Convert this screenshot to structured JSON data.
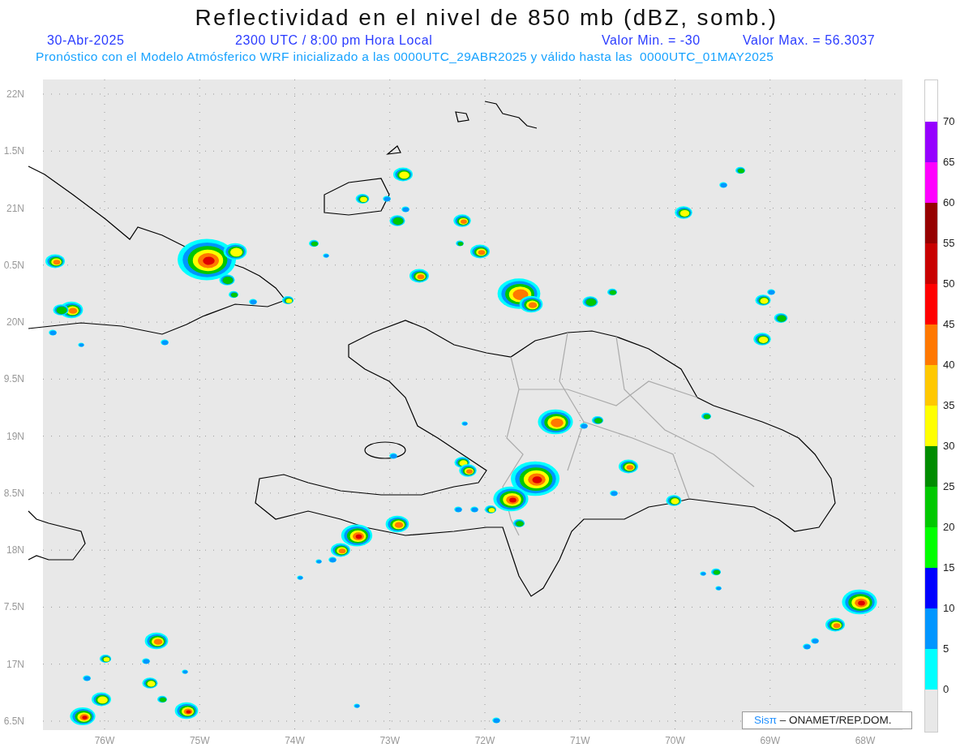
{
  "title": "Reflectividad en el nivel de 850 mb (dBZ, somb.)",
  "info": {
    "date": "30-Abr-2025",
    "time": "2300 UTC / 8:00 pm Hora Local",
    "min": "Valor Min. = -30",
    "max": "Valor Max. = 56.3037"
  },
  "subtitle": "Pronóstico con el Modelo Atmósferico WRF inicializado a las 0000UTC_29ABR2025 y válido hasta las  0000UTC_01MAY2025",
  "map": {
    "lat_labels": [
      "22N",
      "1.5N",
      "21N",
      "0.5N",
      "20N",
      "9.5N",
      "19N",
      "8.5N",
      "18N",
      "7.5N",
      "17N",
      "6.5N"
    ],
    "lon_labels": [
      "76W",
      "75W",
      "74W",
      "73W",
      "72W",
      "71W",
      "70W",
      "69W",
      "68W"
    ],
    "credit": {
      "brand": "Sisπ",
      "org": "– ONAMET/REP.DOM."
    }
  },
  "colorbar": {
    "top_label": "70",
    "bins": [
      {
        "color": "#9600ff",
        "label": "65"
      },
      {
        "color": "#ff00ff",
        "label": "60"
      },
      {
        "color": "#960000",
        "label": "55"
      },
      {
        "color": "#c80000",
        "label": "50"
      },
      {
        "color": "#ff0000",
        "label": "45"
      },
      {
        "color": "#ff7800",
        "label": "40"
      },
      {
        "color": "#ffc800",
        "label": "35"
      },
      {
        "color": "#ffff00",
        "label": "30"
      },
      {
        "color": "#008c00",
        "label": "25"
      },
      {
        "color": "#00c800",
        "label": "20"
      },
      {
        "color": "#00ff00",
        "label": "15"
      },
      {
        "color": "#0000ff",
        "label": "10"
      },
      {
        "color": "#0096ff",
        "label": "5"
      },
      {
        "color": "#00ffff",
        "label": "0"
      }
    ]
  }
}
